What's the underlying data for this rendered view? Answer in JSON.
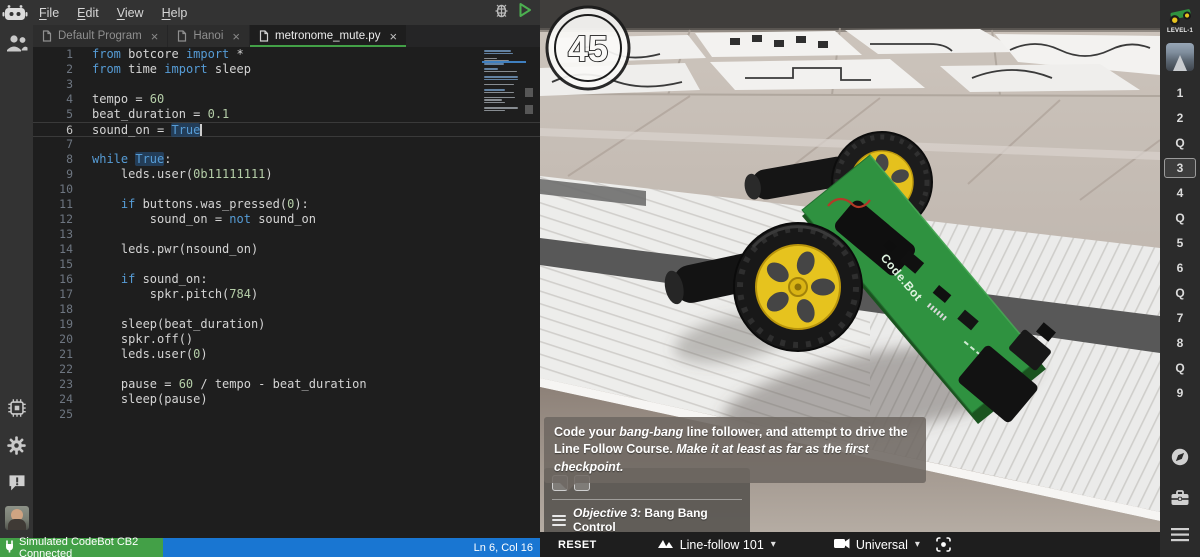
{
  "colors": {
    "accent_green": "#43a047",
    "tab_underline_green": "#4caf50",
    "info_blue": "#1976d2",
    "keyword_blue": "#569cd6",
    "number_green": "#b5cea8",
    "board_green": "#2f9240",
    "wheel_yellow": "#e6c31e"
  },
  "menubar": {
    "menus": [
      "File",
      "Edit",
      "View",
      "Help"
    ]
  },
  "tabs": {
    "close_glyph": "×",
    "items": [
      {
        "label": "Default Program",
        "active": false
      },
      {
        "label": "Hanoi",
        "active": false
      },
      {
        "label": "metronome_mute.py",
        "active": true
      }
    ]
  },
  "editor": {
    "cursor_line": 6,
    "lines": [
      {
        "n": 1,
        "tokens": [
          [
            "k",
            "from"
          ],
          [
            "t",
            " botcore "
          ],
          [
            "k",
            "import"
          ],
          [
            "t",
            " *"
          ]
        ]
      },
      {
        "n": 2,
        "tokens": [
          [
            "k",
            "from"
          ],
          [
            "t",
            " time "
          ],
          [
            "k",
            "import"
          ],
          [
            "t",
            " sleep"
          ]
        ]
      },
      {
        "n": 3,
        "tokens": []
      },
      {
        "n": 4,
        "tokens": [
          [
            "t",
            "tempo = "
          ],
          [
            "n",
            "60"
          ]
        ]
      },
      {
        "n": 5,
        "tokens": [
          [
            "t",
            "beat_duration = "
          ],
          [
            "n",
            "0.1"
          ]
        ]
      },
      {
        "n": 6,
        "tokens": [
          [
            "t",
            "sound_on = "
          ],
          [
            "kh",
            "True"
          ]
        ],
        "current": true
      },
      {
        "n": 7,
        "tokens": []
      },
      {
        "n": 8,
        "tokens": [
          [
            "k",
            "while"
          ],
          [
            "t",
            " "
          ],
          [
            "kh",
            "True"
          ],
          [
            "t",
            ":"
          ]
        ]
      },
      {
        "n": 9,
        "tokens": [
          [
            "t",
            "    leds.user("
          ],
          [
            "n",
            "0b11111111"
          ],
          [
            "t",
            ")"
          ]
        ]
      },
      {
        "n": 10,
        "tokens": []
      },
      {
        "n": 11,
        "tokens": [
          [
            "t",
            "    "
          ],
          [
            "k",
            "if"
          ],
          [
            "t",
            " buttons.was_pressed("
          ],
          [
            "n",
            "0"
          ],
          [
            "t",
            "):"
          ]
        ]
      },
      {
        "n": 12,
        "tokens": [
          [
            "t",
            "        sound_on = "
          ],
          [
            "k",
            "not"
          ],
          [
            "t",
            " sound_on"
          ]
        ]
      },
      {
        "n": 13,
        "tokens": []
      },
      {
        "n": 14,
        "tokens": [
          [
            "t",
            "    leds.pwr(nsound_on)"
          ]
        ]
      },
      {
        "n": 15,
        "tokens": []
      },
      {
        "n": 16,
        "tokens": [
          [
            "t",
            "    "
          ],
          [
            "k",
            "if"
          ],
          [
            "t",
            " sound_on:"
          ]
        ]
      },
      {
        "n": 17,
        "tokens": [
          [
            "t",
            "        spkr.pitch("
          ],
          [
            "n",
            "784"
          ],
          [
            "t",
            ")"
          ]
        ]
      },
      {
        "n": 18,
        "tokens": []
      },
      {
        "n": 19,
        "tokens": [
          [
            "t",
            "    sleep(beat_duration)"
          ]
        ]
      },
      {
        "n": 20,
        "tokens": [
          [
            "t",
            "    spkr.off()"
          ]
        ]
      },
      {
        "n": 21,
        "tokens": [
          [
            "t",
            "    leds.user("
          ],
          [
            "n",
            "0"
          ],
          [
            "t",
            ")"
          ]
        ]
      },
      {
        "n": 22,
        "tokens": []
      },
      {
        "n": 23,
        "tokens": [
          [
            "t",
            "    pause = "
          ],
          [
            "n",
            "60"
          ],
          [
            "t",
            " / tempo - beat_duration"
          ]
        ]
      },
      {
        "n": 24,
        "tokens": [
          [
            "t",
            "    sleep(pause)"
          ]
        ]
      },
      {
        "n": 25,
        "tokens": []
      }
    ]
  },
  "status_bar": {
    "connection": "Simulated CodeBot CB2 Connected",
    "position": "Ln 6, Col 16"
  },
  "simulation": {
    "checkpoint_badge": "45",
    "robot_label": "Code.Bot",
    "tooltip_parts": [
      {
        "text": "Code your ",
        "italic": false
      },
      {
        "text": "bang-bang",
        "italic": true
      },
      {
        "text": " line follower, and attempt to drive the Line Follow Course. ",
        "italic": false
      },
      {
        "text": "Make it at least as far as the first checkpoint.",
        "italic": true
      }
    ],
    "objective": {
      "prefix": "Objective 3:",
      "title": " Bang Bang Control"
    },
    "bottom_bar": {
      "reset": "RESET",
      "scene": "Line-follow 101",
      "camera": "Universal",
      "caret_glyph": "▾"
    }
  },
  "right_sidebar": {
    "level_label": "LEVEL-1",
    "items": [
      {
        "label": "1"
      },
      {
        "label": "2"
      },
      {
        "label": "Q"
      },
      {
        "label": "3",
        "selected": true
      },
      {
        "label": "4"
      },
      {
        "label": "Q"
      },
      {
        "label": "5"
      },
      {
        "label": "6"
      },
      {
        "label": "Q"
      },
      {
        "label": "7"
      },
      {
        "label": "8"
      },
      {
        "label": "Q"
      },
      {
        "label": "9"
      }
    ]
  }
}
